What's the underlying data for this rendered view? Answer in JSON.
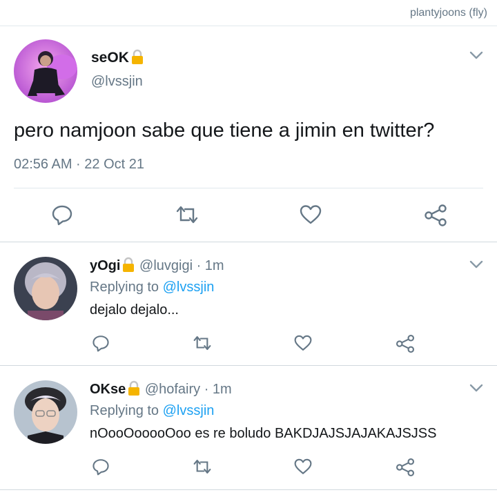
{
  "header": {
    "handle": "plantyjoons (fly)"
  },
  "main_tweet": {
    "display_name": "seOK",
    "username": "@lvssjin",
    "text": "pero namjoon sabe que tiene a jimin en twitter?",
    "timestamp": "02:56 AM · 22 Oct 21"
  },
  "replies": [
    {
      "display_name": "yOgi",
      "meta": "@luvgigi · 1m",
      "replying_prefix": "Replying to",
      "replying_to": "@lvssjin",
      "text": "dejalo dejalo..."
    },
    {
      "display_name": "OKse",
      "meta": "@hofairy · 1m",
      "replying_prefix": "Replying to",
      "replying_to": "@lvssjin",
      "text": "nOooOooooOoo es re boludo BAKDJAJSJAJAKAJSJSS"
    }
  ],
  "icons": [
    "reply-icon",
    "retweet-icon",
    "like-icon",
    "share-icon",
    "chevron-down-icon",
    "lock-icon"
  ],
  "colors": {
    "link": "#1da1f2",
    "secondary_text": "#657786",
    "icon": "#657786",
    "lock": "#f5b400"
  }
}
